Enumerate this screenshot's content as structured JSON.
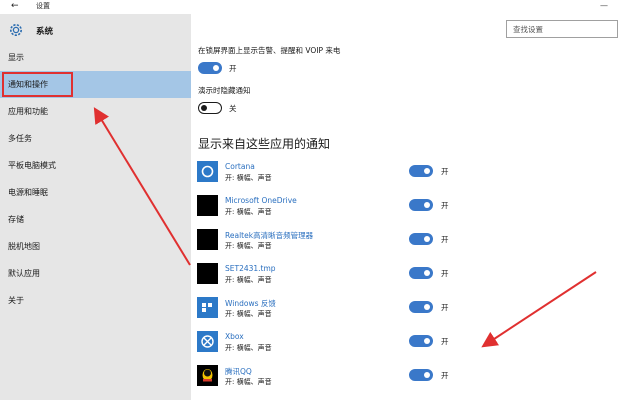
{
  "window": {
    "back": "←",
    "title": "设置",
    "controls": "—"
  },
  "sidebar": {
    "header": "系统",
    "items": [
      {
        "label": "显示",
        "selected": false
      },
      {
        "label": "通知和操作",
        "selected": true
      },
      {
        "label": "应用和功能",
        "selected": false
      },
      {
        "label": "多任务",
        "selected": false
      },
      {
        "label": "平板电脑模式",
        "selected": false
      },
      {
        "label": "电源和睡眠",
        "selected": false
      },
      {
        "label": "存储",
        "selected": false
      },
      {
        "label": "脱机地图",
        "selected": false
      },
      {
        "label": "默认应用",
        "selected": false
      },
      {
        "label": "关于",
        "selected": false
      }
    ]
  },
  "search": {
    "placeholder": "查找设置"
  },
  "settings": {
    "lockscreen": {
      "label": "在锁屏界面上显示告警、提醒和 VOIP 来电",
      "state": "开"
    },
    "presenting": {
      "label": "演示时隐藏通知",
      "state": "关"
    }
  },
  "apps_section": {
    "title": "显示来自这些应用的通知",
    "apps": [
      {
        "name": "Cortana",
        "sub": "开: 横幅、声音",
        "state": "开",
        "icon": "cortana-icon"
      },
      {
        "name": "Microsoft OneDrive",
        "sub": "开: 横幅、声音",
        "state": "开",
        "icon": "onedrive-icon"
      },
      {
        "name": "Realtek高清晰音频管理器",
        "sub": "开: 横幅、声音",
        "state": "开",
        "icon": "realtek-icon"
      },
      {
        "name": "SET2431.tmp",
        "sub": "开: 横幅、声音",
        "state": "开",
        "icon": "setup-icon"
      },
      {
        "name": "Windows 反馈",
        "sub": "开: 横幅、声音",
        "state": "开",
        "icon": "feedback-icon"
      },
      {
        "name": "Xbox",
        "sub": "开: 横幅、声音",
        "state": "开",
        "icon": "xbox-icon"
      },
      {
        "name": "腾讯QQ",
        "sub": "开: 横幅、声音",
        "state": "开",
        "icon": "qq-icon"
      }
    ]
  },
  "colors": {
    "accent": "#3a78c9",
    "sidebar_bg": "#e6e6e6",
    "selected_bg": "#a4c6e6",
    "annotation": "#e03030"
  }
}
